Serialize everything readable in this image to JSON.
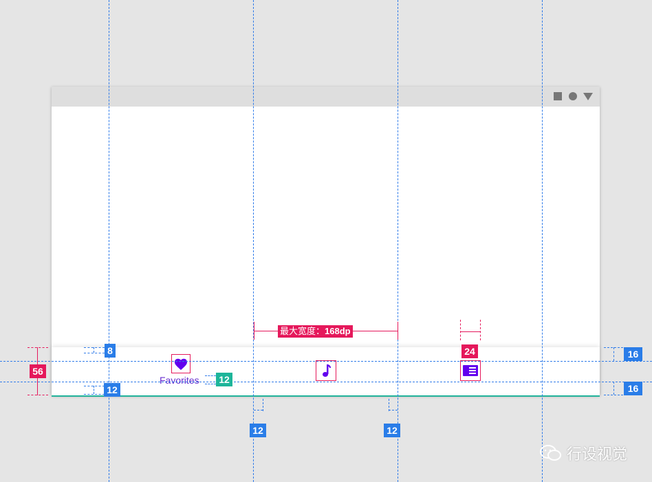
{
  "nav": {
    "items": [
      {
        "label": "Favorites",
        "icon": "heart-icon"
      },
      {
        "label": "",
        "icon": "music-note-icon"
      },
      {
        "label": "",
        "icon": "news-icon"
      }
    ]
  },
  "specs": {
    "nav_height": "56",
    "top_padding": "8",
    "bottom_padding": "12",
    "icon_size": "24",
    "label_gap": "12",
    "item_padding_left": "12",
    "item_padding_right": "12",
    "right_top": "16",
    "right_bottom": "16",
    "max_width_label": "最大宽度：",
    "max_width_value": "168dp"
  },
  "watermark": "行设视觉",
  "colors": {
    "accent": "#6200ee",
    "guide_blue": "#2a7de8",
    "spec_red": "#e5185b",
    "spec_teal": "#1db59a"
  }
}
